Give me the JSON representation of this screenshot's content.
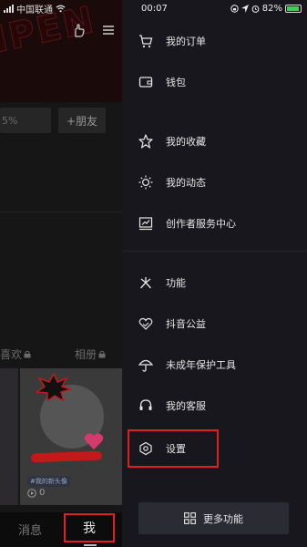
{
  "status_bar": {
    "carrier": "中国联通",
    "time": "00:07",
    "battery": "82%"
  },
  "profile_background": {
    "add_friend": "+朋友",
    "percent_partial": "5%",
    "tab_likes": "喜欢",
    "tab_album": "相册",
    "video_tag": "#我的新头像",
    "video_plays": "0",
    "nav_messages": "消息",
    "nav_me": "我"
  },
  "drawer": {
    "items": [
      {
        "label": "我的订单",
        "icon": "cart-icon"
      },
      {
        "label": "钱包",
        "icon": "wallet-icon"
      },
      {
        "label": "我的收藏",
        "icon": "star-icon"
      },
      {
        "label": "我的动态",
        "icon": "activity-icon"
      },
      {
        "label": "创作者服务中心",
        "icon": "chart-icon"
      },
      {
        "label": "功能",
        "icon": "function-icon"
      },
      {
        "label": "抖音公益",
        "icon": "heart-hands-icon"
      },
      {
        "label": "未成年保护工具",
        "icon": "umbrella-icon"
      },
      {
        "label": "我的客服",
        "icon": "headset-icon"
      },
      {
        "label": "设置",
        "icon": "settings-hex-icon"
      }
    ],
    "more_button": "更多功能"
  },
  "colors": {
    "drawer_bg": "#17171d",
    "highlight": "#e02020",
    "more_btn_bg": "#2b2b33"
  }
}
